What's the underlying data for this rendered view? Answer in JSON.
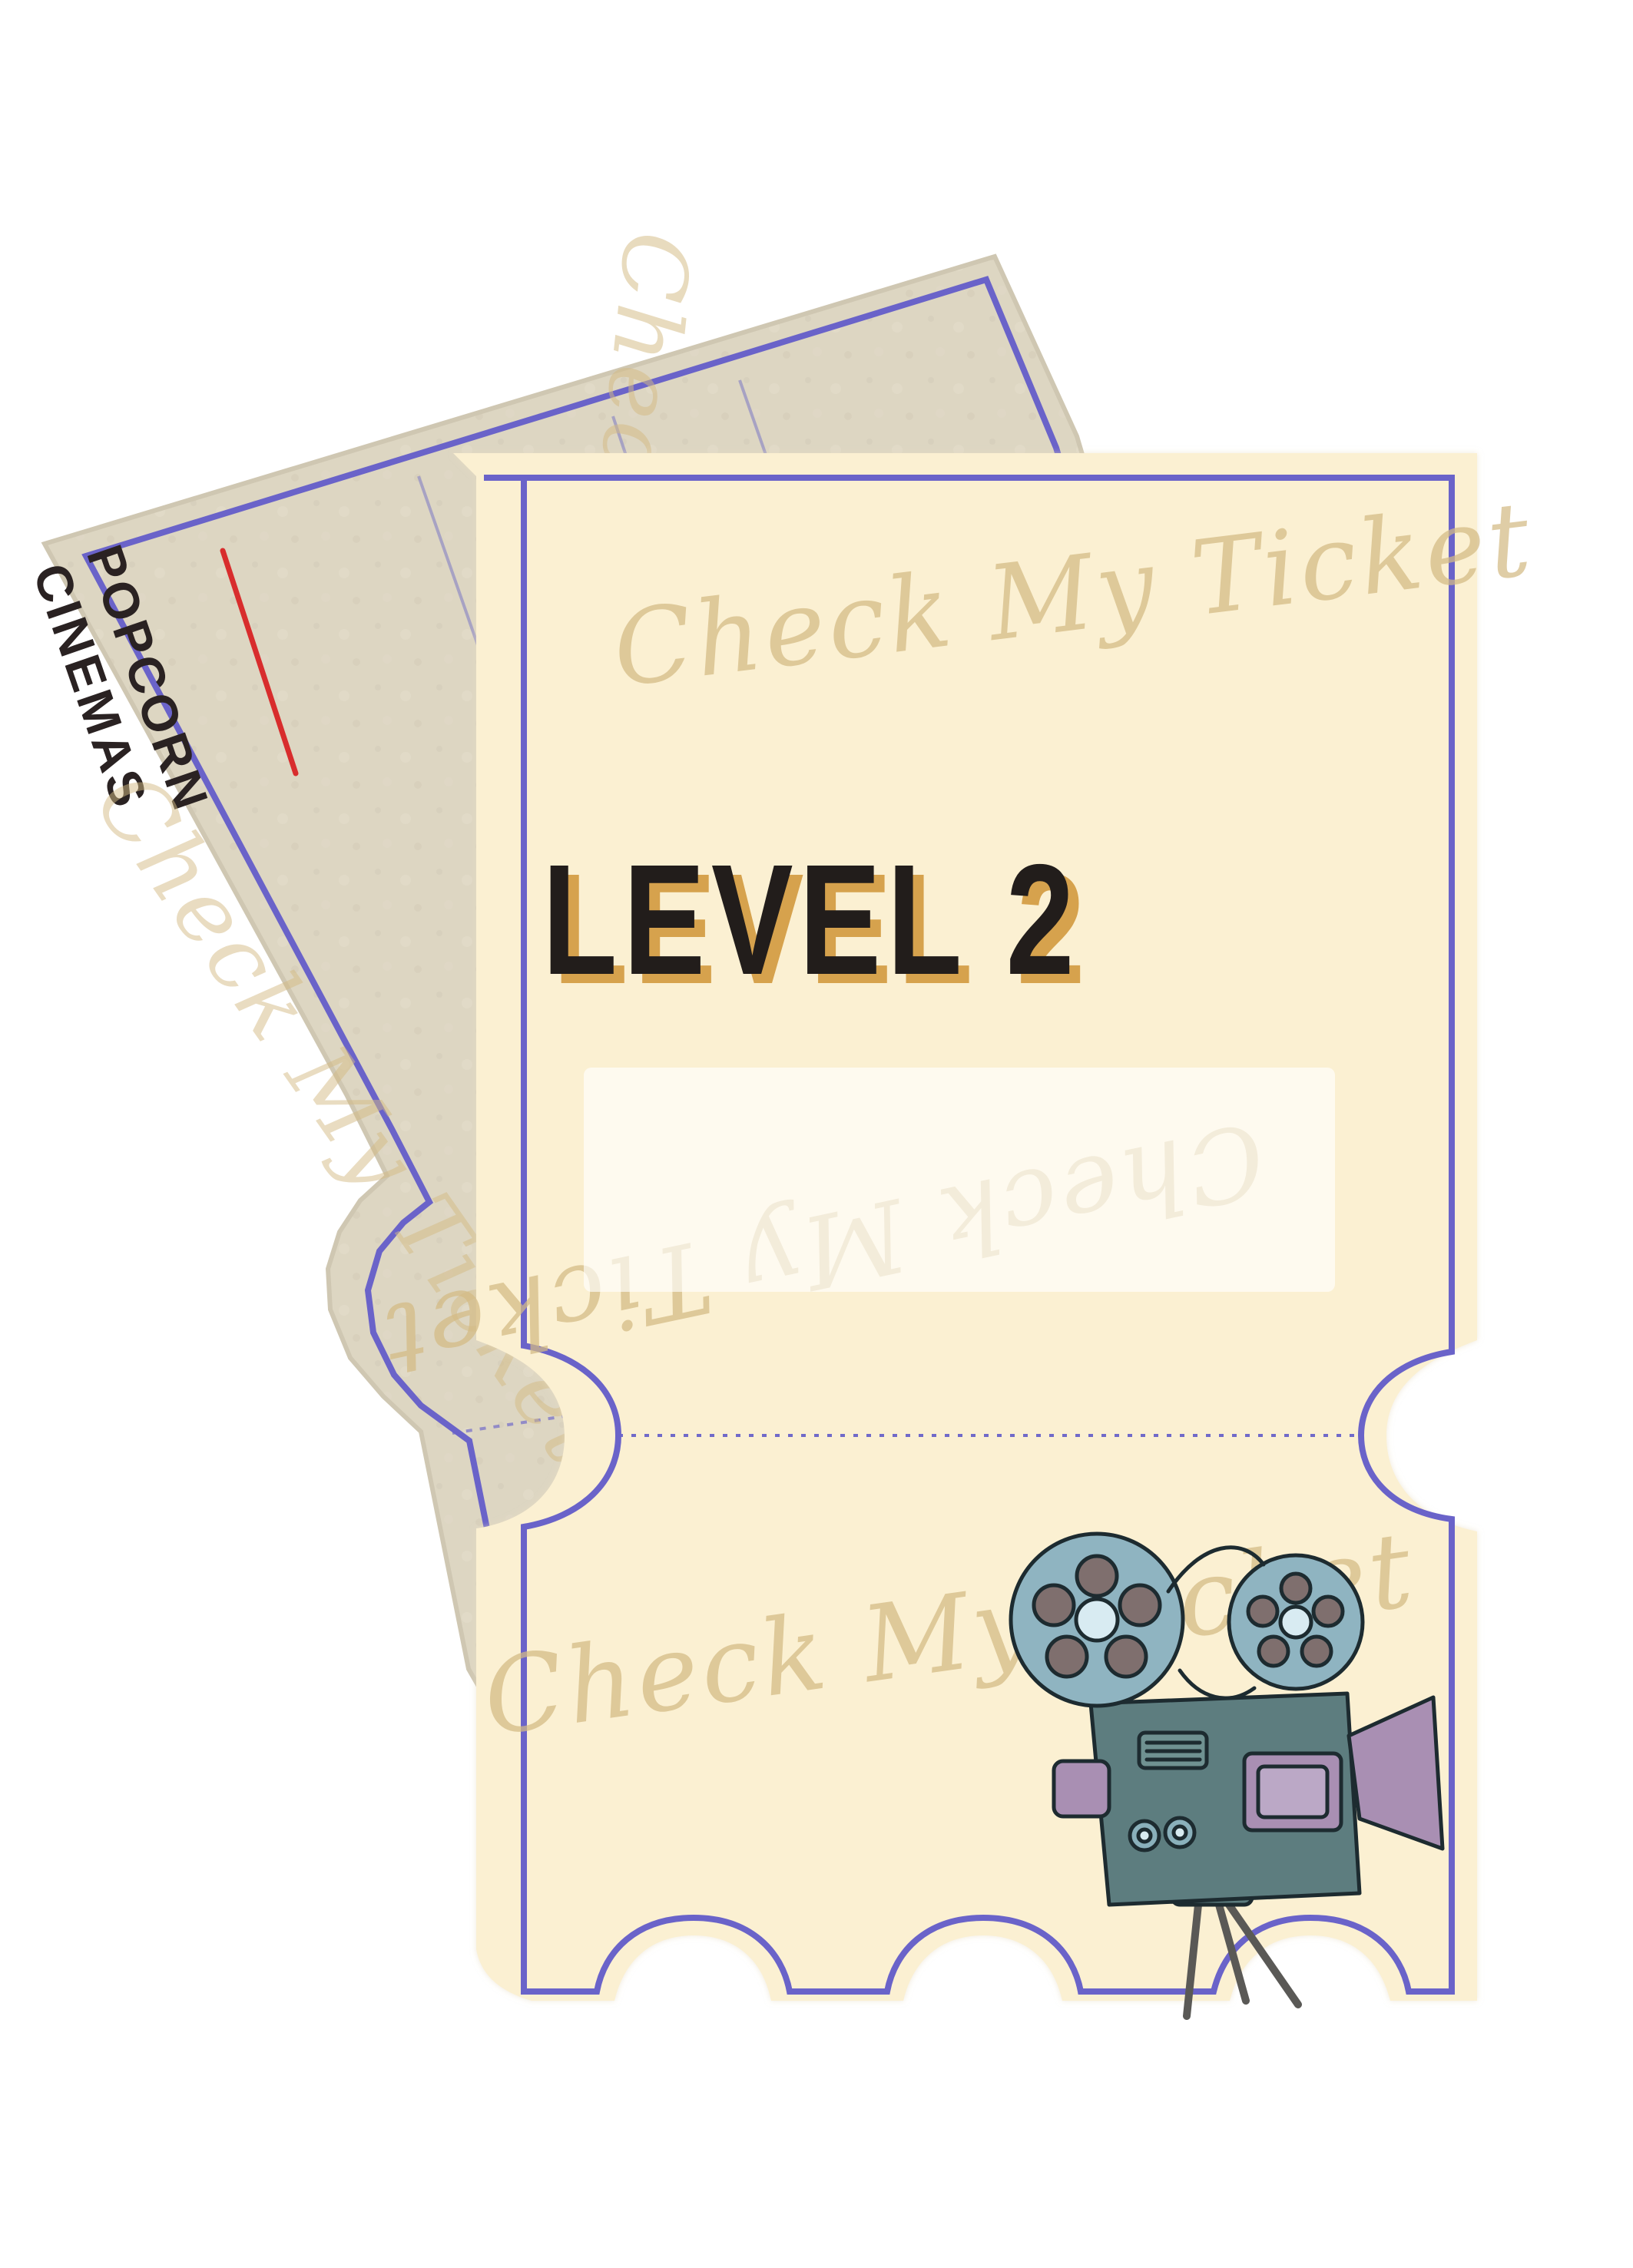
{
  "brand": {
    "line1": "POPCORN",
    "line2": "CINEMAS"
  },
  "ticket": {
    "title": "LEVEL 2",
    "name_field": ""
  },
  "watermarks": {
    "primary": "Check My Ticket"
  },
  "illustration": {
    "projector_icon": "film-projector-icon"
  },
  "colors": {
    "page_background": "#ffffff",
    "back_ticket": "#ddd6c2",
    "front_ticket": "#fbf0d2",
    "border": "#6a63c9",
    "title": "#221d1b",
    "title_shadow": "#d39a3f",
    "accent_red": "#d82d2d",
    "watermark": "#d4bb84",
    "projector_body": "#5d7d7f",
    "projector_reel": "#8fb4c1",
    "projector_panel": "#a98fb3"
  }
}
